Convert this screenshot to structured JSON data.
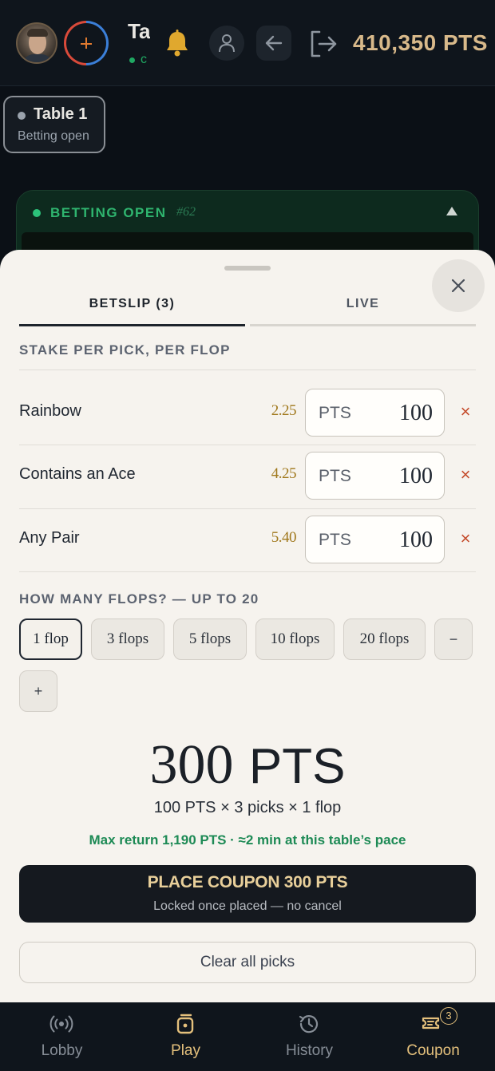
{
  "header": {
    "table_name_fragment": "Ta",
    "status_fragment": "c",
    "points": "410,350 PTS"
  },
  "table_chip": {
    "name": "Table 1",
    "status": "Betting open"
  },
  "betting_panel": {
    "label": "BETTING OPEN",
    "round": "#62"
  },
  "betslip": {
    "tabs": [
      {
        "label": "BETSLIP (3)",
        "active": true
      },
      {
        "label": "LIVE",
        "active": false
      }
    ],
    "stake_label": "STAKE PER PICK, PER FLOP",
    "picks": [
      {
        "name": "Rainbow",
        "odds": "2.25",
        "unit": "PTS",
        "stake": "100"
      },
      {
        "name": "Contains an Ace",
        "odds": "4.25",
        "unit": "PTS",
        "stake": "100"
      },
      {
        "name": "Any Pair",
        "odds": "5.40",
        "unit": "PTS",
        "stake": "100"
      }
    ],
    "remove_symbol": "×",
    "flops_label": "HOW MANY FLOPS? — UP TO 20",
    "flop_options": [
      {
        "label": "1 flop",
        "selected": true
      },
      {
        "label": "3 flops",
        "selected": false
      },
      {
        "label": "5 flops",
        "selected": false
      },
      {
        "label": "10 flops",
        "selected": false
      },
      {
        "label": "20 flops",
        "selected": false
      }
    ],
    "decrement": "−",
    "increment": "+",
    "total_number": "300",
    "total_unit": "PTS",
    "breakdown": "100 PTS × 3 picks × 1 flop",
    "max_return": "Max return 1,190 PTS · ≈2 min at this table’s pace",
    "place_button": "PLACE COUPON 300 PTS",
    "place_sub": "Locked once placed — no cancel",
    "clear_button": "Clear all picks",
    "close_symbol": "×"
  },
  "nav": {
    "items": [
      {
        "label": "Lobby",
        "icon": "broadcast-icon",
        "active": false
      },
      {
        "label": "Play",
        "icon": "dice-icon",
        "active": true
      },
      {
        "label": "History",
        "icon": "history-icon",
        "active": false
      },
      {
        "label": "Coupon",
        "icon": "ticket-icon",
        "active": true,
        "badge": "3"
      }
    ]
  },
  "colors": {
    "accent_gold": "#d8b98a",
    "success_green": "#1d8a55",
    "remove_red": "#c44a2a",
    "sheet_bg": "#f6f3ee",
    "dark_bg": "#0f151c"
  }
}
